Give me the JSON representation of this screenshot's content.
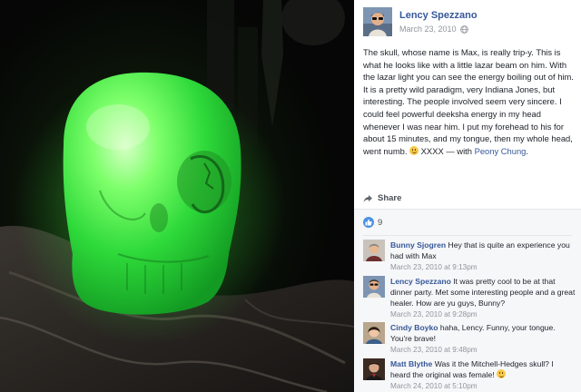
{
  "photo": {
    "alt_subject": "glowing green crystal skull"
  },
  "post": {
    "author": "Lency Spezzano",
    "date": "March 23, 2010",
    "text_main": "The skull, whose name is Max, is really trip-y. This is what he looks like with a little lazar beam on him. With the lazar light you can see the energy boiling out of him. It is a pretty wild paradigm, very Indiana Jones, but interesting. The people involved seem very sincere. I could feel powerful deeksha energy in my head whenever I was near him. I put my forehead to his for about 15 minutes, and my tongue, then my whole head, went numb.",
    "text_suffix": " XXXX",
    "with_prefix": "— with ",
    "with_person": "Peony Chung",
    "with_suffix": ".",
    "share_label": "Share",
    "like_count": "9"
  },
  "comments": [
    {
      "author": "Bunny Sjogren",
      "text": " Hey that is quite an experience you had with Max",
      "time": "March 23, 2010 at 9:13pm"
    },
    {
      "author": "Lency Spezzano",
      "text": " It was pretty cool to be at that dinner party. Met some interesting people and a great healer. How are yu guys, Bunny?",
      "time": "March 23, 2010 at 9:28pm"
    },
    {
      "author": "Cindy Boyko",
      "text": " haha, Lency. Funny, your tongue. You're brave!",
      "time": "March 23, 2010 at 9:48pm"
    },
    {
      "author": "Matt Blythe",
      "text": " Was it the Mitchell-Hedges skull? I heard the original was female!",
      "time": "March 24, 2010 at 5:10pm"
    }
  ],
  "colors": {
    "link": "#365899",
    "text": "#1d2129",
    "meta": "#90949c",
    "like_blue": "#4a90e2",
    "skull_glow": "#39ff3a"
  },
  "icons": [
    "globe-icon",
    "share-icon",
    "like-icon",
    "smile-emoji-icon"
  ]
}
